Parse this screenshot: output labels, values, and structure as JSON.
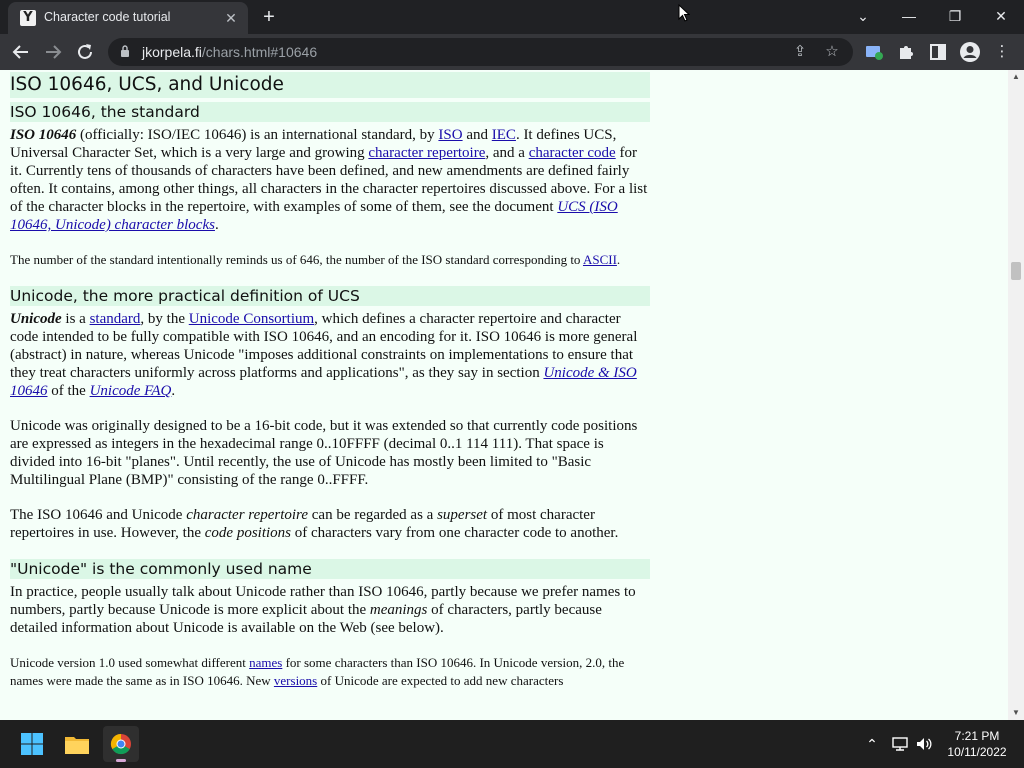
{
  "browser": {
    "tab_title": "Character code tutorial",
    "tab_close": "✕",
    "new_tab": "+",
    "url_host": "jkorpela.fi",
    "url_path": "/chars.html#10646",
    "window_controls": {
      "minimize": "—",
      "restore": "❐",
      "close": "✕",
      "tab_search": "⌄"
    }
  },
  "article": {
    "h2_main": "ISO 10646, UCS, and Unicode",
    "sec1": {
      "heading": "ISO 10646, the standard",
      "p1": {
        "term": "ISO 10646",
        "t1": " (officially: ISO/IEC 10646) is an international standard, by ",
        "link_iso": "ISO",
        "t2": " and ",
        "link_iec": "IEC",
        "t3": ". It defines UCS, Universal Character Set, which is a very large and growing ",
        "link_repertoire": "character repertoire",
        "t4": ", and a ",
        "link_code": "character code",
        "t5": " for it. Currently tens of thousands of characters have been defined, and new amendments are defined fairly often. It contains, among other things, all characters in the character repertoires discussed above. For a list of the character blocks in the repertoire, with examples of some of them, see the document ",
        "link_blocks": "UCS (ISO 10646, Unicode) character blocks",
        "t6": "."
      },
      "p2": {
        "t1": "The number of the standard intentionally reminds us of 646, the number of the ISO standard corresponding to ",
        "link_ascii": "ASCII",
        "t2": "."
      }
    },
    "sec2": {
      "heading": "Unicode, the more practical definition of UCS",
      "p1": {
        "term": "Unicode",
        "t1": " is a ",
        "link_standard": "standard",
        "t2": ", by the ",
        "link_consortium": "Unicode Consortium",
        "t3": ", which defines a character repertoire and character code intended to be fully compatible with ISO 10646, and an encoding for it. ISO 10646 is more general (abstract) in nature, whereas Unicode \"imposes additional constraints on implementations to ensure that they treat characters uniformly across platforms and applications\", as they say in section ",
        "link_uni_iso": "Unicode & ISO 10646",
        "t4": " of the ",
        "link_faq": "Unicode FAQ",
        "t5": "."
      },
      "p2": "Unicode was originally designed to be a 16-bit code, but it was extended so that currently code positions are expressed as integers in the hexadecimal range 0..10FFFF (decimal 0..1 114 111). That space is divided into 16-bit \"planes\". Until recently, the use of Unicode has mostly been limited to \"Basic Multilingual Plane (BMP)\" consisting of the range 0..FFFF.",
      "p3": {
        "t1": "The ISO 10646 and Unicode ",
        "em1": "character repertoire",
        "t2": " can be regarded as a ",
        "em2": "superset",
        "t3": " of most character repertoires in use. However, the ",
        "em3": "code positions",
        "t4": " of characters vary from one character code to another."
      }
    },
    "sec3": {
      "heading": "\"Unicode\" is the commonly used name",
      "p1": {
        "t1": "In practice, people usually talk about Unicode rather than ISO 10646, partly because we prefer names to numbers, partly because Unicode is more explicit about the ",
        "em1": "meanings",
        "t2": " of characters, partly because detailed information about Unicode is available on the Web (see below)."
      },
      "p2": {
        "t1": "Unicode version 1.0 used somewhat different ",
        "link_names": "names",
        "t2": " for some characters than ISO 10646. In Unicode version, 2.0, the names were made the same as in ISO 10646. New ",
        "link_versions": "versions",
        "t3": " of Unicode are expected to add new characters"
      }
    }
  },
  "taskbar": {
    "time": "7:21 PM",
    "date": "10/11/2022"
  }
}
